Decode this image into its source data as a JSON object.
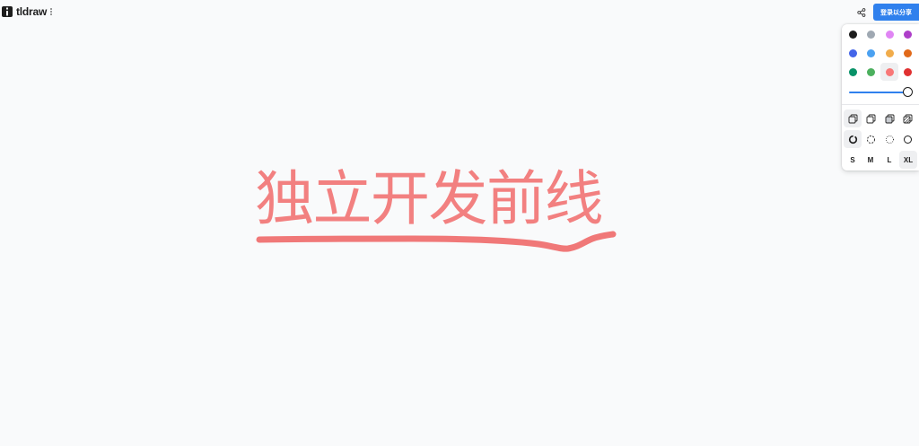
{
  "app": {
    "name": "tldraw"
  },
  "header": {
    "login_share_label": "登录以分享"
  },
  "style_panel": {
    "colors": [
      {
        "name": "black",
        "hex": "#1d1d1d"
      },
      {
        "name": "grey",
        "hex": "#9fa8b2"
      },
      {
        "name": "light-violet",
        "hex": "#e085f4"
      },
      {
        "name": "violet",
        "hex": "#ae3ec9"
      },
      {
        "name": "blue",
        "hex": "#4465e9"
      },
      {
        "name": "light-blue",
        "hex": "#4ba1f1"
      },
      {
        "name": "yellow",
        "hex": "#f1ac4b"
      },
      {
        "name": "orange",
        "hex": "#e16919"
      },
      {
        "name": "green",
        "hex": "#099268"
      },
      {
        "name": "light-green",
        "hex": "#4cb05e"
      },
      {
        "name": "light-red",
        "hex": "#f87777"
      },
      {
        "name": "red",
        "hex": "#e03131"
      }
    ],
    "selected_color": "light-red",
    "opacity": 1.0,
    "fill_options": [
      "none",
      "semi",
      "solid",
      "pattern"
    ],
    "selected_fill": "none",
    "dash_options": [
      "draw",
      "dashed",
      "dotted",
      "solid"
    ],
    "selected_dash": "draw",
    "sizes": [
      "S",
      "M",
      "L",
      "XL"
    ],
    "selected_size": "XL"
  },
  "canvas": {
    "text": "独立开发前线",
    "stroke_color": "#f07878"
  }
}
